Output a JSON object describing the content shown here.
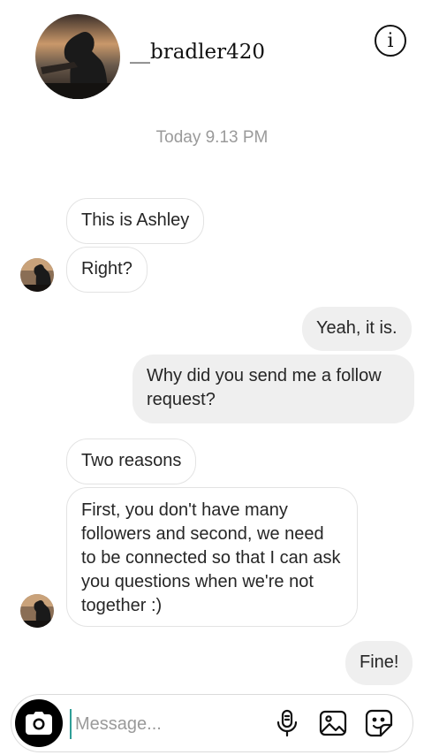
{
  "header": {
    "username": "__bradler420",
    "info_icon": "info-icon"
  },
  "thread": {
    "timestamp": "Today 9.13 PM",
    "messages": [
      {
        "from": "them",
        "text": "This is Ashley"
      },
      {
        "from": "them",
        "text": "Right?"
      },
      {
        "from": "me",
        "text": "Yeah, it is."
      },
      {
        "from": "me",
        "text": "Why did you send me a follow request?"
      },
      {
        "from": "them",
        "text": "Two reasons"
      },
      {
        "from": "them",
        "text": "First, you don't have many followers and second, we need to be connected so that I can ask you questions when we're not together :)"
      },
      {
        "from": "me",
        "text": "Fine!"
      }
    ]
  },
  "composer": {
    "placeholder": "Message...",
    "icons": [
      "camera-icon",
      "microphone-icon",
      "gallery-icon",
      "sticker-icon"
    ]
  },
  "colors": {
    "outgoing_bubble": "#efefef",
    "incoming_border": "#e3e3e3",
    "timestamp_text": "#9a9a9a",
    "caret": "#2f9e97"
  }
}
